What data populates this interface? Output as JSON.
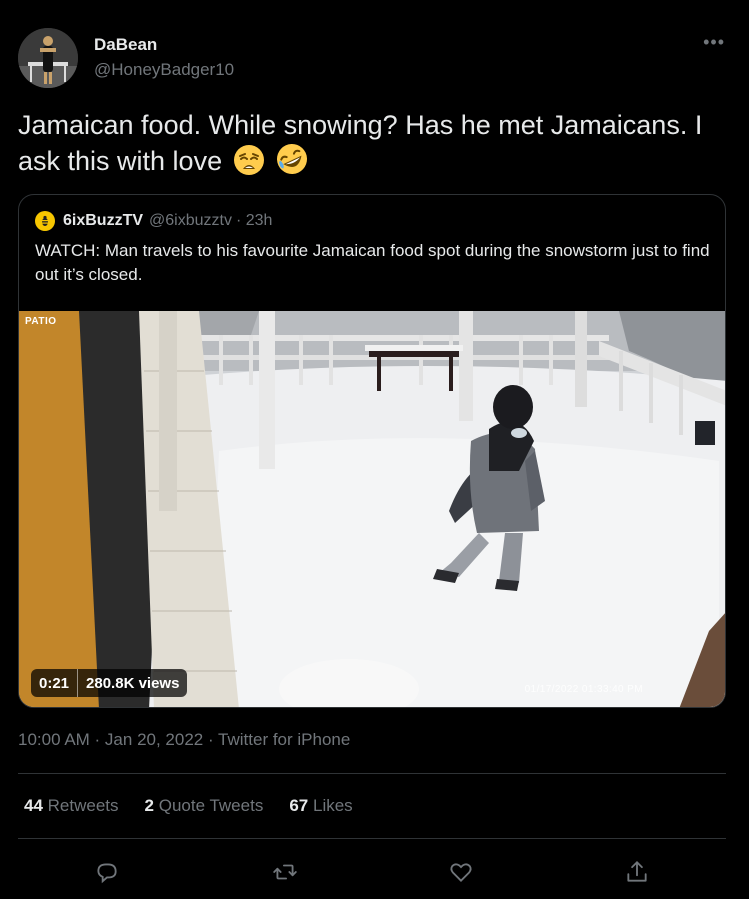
{
  "author": {
    "name": "DaBean",
    "handle": "@HoneyBadger10",
    "more_icon": "ellipsis-icon"
  },
  "tweet": {
    "text": "Jamaican food. While snowing? Has he met Jamaicans. I ask this with love",
    "emojis": [
      "weary-face",
      "rolling-on-floor-laughing"
    ]
  },
  "quote": {
    "name": "6ixBuzzTV",
    "handle": "@6ixbuzztv",
    "time": "· 23h",
    "text": "WATCH: Man travels to his favourite Jamaican food spot during the snowstorm just to find out it’s closed.",
    "media": {
      "camera_label": "PATIO",
      "timestamp": "01/17/2022 01:33:40 PM",
      "duration": "0:21",
      "views": "280.8K views"
    }
  },
  "meta": {
    "time": "10:00 AM · Jan 20, 2022 · ",
    "source": "Twitter for iPhone"
  },
  "stats": {
    "retweets_count": "44",
    "retweets_label": "Retweets",
    "quotes_count": "2",
    "quotes_label": "Quote Tweets",
    "likes_count": "67",
    "likes_label": "Likes"
  },
  "actions": [
    "reply-icon",
    "retweet-icon",
    "like-icon",
    "share-icon"
  ],
  "colors": {
    "background": "#000000",
    "text": "#e7e9ea",
    "secondary": "#71767b",
    "border": "#2f3336",
    "badge_yellow": "#f7c600"
  }
}
